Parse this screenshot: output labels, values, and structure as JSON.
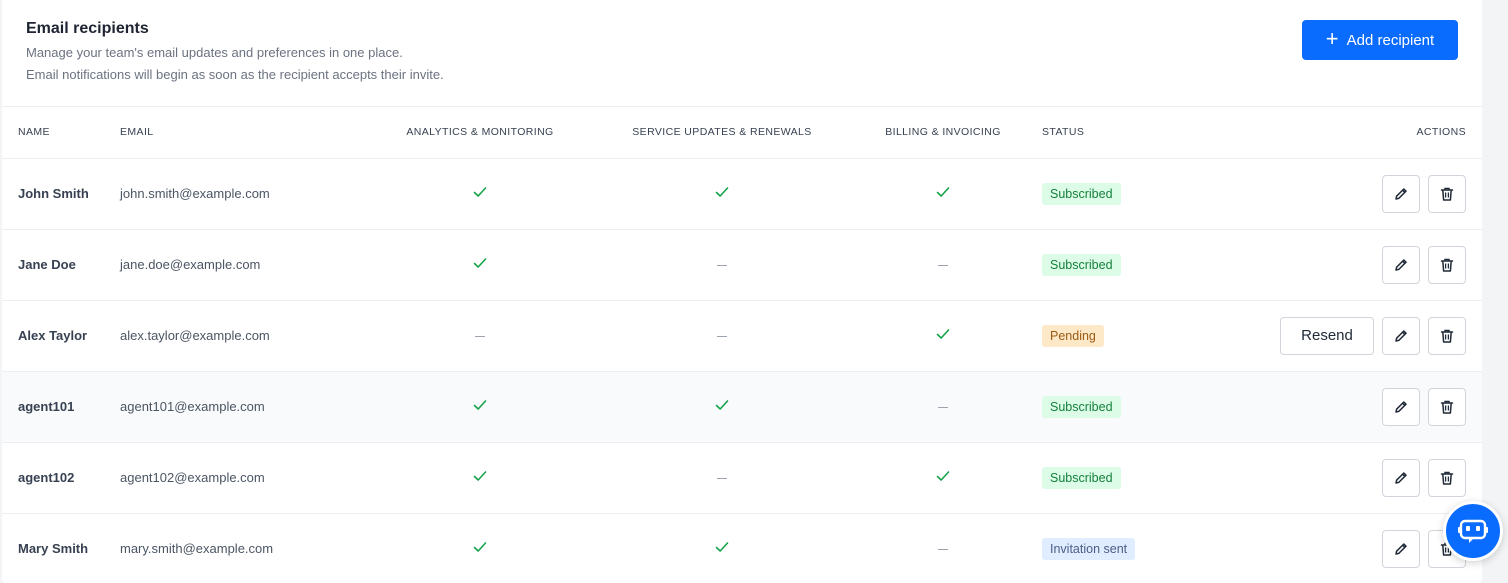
{
  "header": {
    "title": "Email recipients",
    "description_line1": "Manage your team's email updates and preferences in one place.",
    "description_line2": "Email notifications will begin as soon as the recipient accepts their invite.",
    "add_button_label": "Add recipient"
  },
  "table": {
    "columns": {
      "name": "NAME",
      "email": "EMAIL",
      "analytics": "ANALYTICS & MONITORING",
      "service": "SERVICE UPDATES & RENEWALS",
      "billing": "BILLING & INVOICING",
      "status": "STATUS",
      "actions": "ACTIONS"
    },
    "rows": [
      {
        "name": "John Smith",
        "email": "john.smith@example.com",
        "analytics": true,
        "service": true,
        "billing": true,
        "status": "Subscribed",
        "status_type": "subscribed",
        "resend": false
      },
      {
        "name": "Jane Doe",
        "email": "jane.doe@example.com",
        "analytics": true,
        "service": false,
        "billing": false,
        "status": "Subscribed",
        "status_type": "subscribed",
        "resend": false
      },
      {
        "name": "Alex Taylor",
        "email": "alex.taylor@example.com",
        "analytics": false,
        "service": false,
        "billing": true,
        "status": "Pending",
        "status_type": "pending",
        "resend": true
      },
      {
        "name": "agent101",
        "email": "agent101@example.com",
        "analytics": true,
        "service": true,
        "billing": false,
        "status": "Subscribed",
        "status_type": "subscribed",
        "resend": false
      },
      {
        "name": "agent102",
        "email": "agent102@example.com",
        "analytics": true,
        "service": false,
        "billing": true,
        "status": "Subscribed",
        "status_type": "subscribed",
        "resend": false
      },
      {
        "name": "Mary Smith",
        "email": "mary.smith@example.com",
        "analytics": true,
        "service": true,
        "billing": false,
        "status": "Invitation sent",
        "status_type": "invited",
        "resend": false
      }
    ],
    "resend_label": "Resend"
  },
  "icons": {
    "check": "check-icon",
    "dash": "dash-icon",
    "edit": "pencil-icon",
    "delete": "trash-icon",
    "chat": "chat-bot-icon",
    "add": "plus-icon"
  },
  "colors": {
    "primary": "#0a6cff",
    "check": "#16a34a",
    "subscribed_bg": "#dcfce7",
    "pending_bg": "#fde8c8",
    "invited_bg": "#e0ecff"
  }
}
